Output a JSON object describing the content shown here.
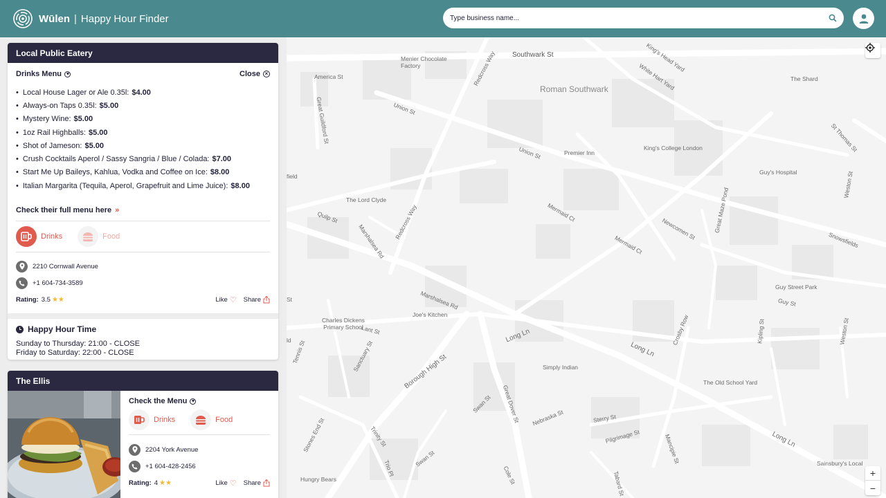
{
  "header": {
    "brand": "Wūlen",
    "separator": "|",
    "subtitle": "Happy Hour Finder",
    "search_placeholder": "Type business name..."
  },
  "colors": {
    "header_bg": "#4a8a8e",
    "card_header_bg": "#2b2842",
    "accent": "#e05a4e",
    "star": "#f5b82e"
  },
  "card1": {
    "title": "Local Public Eatery",
    "menu_title": "Drinks Menu",
    "close_label": "Close",
    "items": [
      {
        "name": "Local House Lager or Ale 0.35l:",
        "price": "$4.00"
      },
      {
        "name": "Always-on Taps 0.35l:",
        "price": "$5.00"
      },
      {
        "name": "Mystery Wine:",
        "price": "$5.00"
      },
      {
        "name": "1oz Rail Highballs:",
        "price": "$5.00"
      },
      {
        "name": "Shot of Jameson:",
        "price": "$5.00"
      },
      {
        "name": "Crush Cocktails Aperol / Sassy Sangria / Blue / Colada:",
        "price": "$7.00"
      },
      {
        "name": "Start Me Up Baileys, Kahlua, Vodka and Coffee on Ice:",
        "price": "$8.00"
      },
      {
        "name": "Italian Margarita (Tequila, Aperol, Grapefruit and Lime Juice):",
        "price": "$8.00"
      }
    ],
    "full_menu_link": "Check their full menu here",
    "drinks_label": "Drinks",
    "food_label": "Food",
    "address": "2210 Cornwall Avenue",
    "phone": "+1 604-734-3589",
    "rating_label": "Rating:",
    "rating_value": "3.5",
    "rating_stars": "★★",
    "like_label": "Like",
    "share_label": "Share",
    "happy_hour_title": "Happy Hour Time",
    "happy_hour_lines": [
      "Sunday to Thursday: 21:00 - CLOSE",
      "Friday to Saturday: 22:00 - CLOSE"
    ]
  },
  "card2": {
    "title": "The Ellis",
    "menu_link": "Check the Menu",
    "drinks_label": "Drinks",
    "food_label": "Food",
    "address": "2204 York Avenue",
    "phone": "+1 604-428-2456",
    "rating_label": "Rating:",
    "rating_value": "4",
    "rating_stars": "★★",
    "like_label": "Like",
    "share_label": "Share"
  },
  "map": {
    "labels": [
      "Southwark St",
      "Menier Chocolate Factory",
      "America St",
      "Redcross Way",
      "King's Head Yard",
      "White Hart Yard",
      "The Shard",
      "Roman Southwark",
      "Great Guildford St",
      "Union St",
      "St Thomas St",
      "Premier Inn",
      "Union St",
      "King's College London",
      "Guy's Hospital",
      "Weston St",
      "The Lord Clyde",
      "Quilp St",
      "Redcross Way",
      "Mermaid Ct",
      "Great Maze Pond",
      "Newcomen St",
      "Snowsfields",
      "Marshalsea Rd",
      "Mermaid Ct",
      "Guy Street Park",
      "Guy St",
      "Marshalsea Rd",
      "Joe's Kitchen",
      "Charles Dickens Primary School",
      "Lant St",
      "Long Ln",
      "Crosby Row",
      "Kipling St",
      "Weston St",
      "Long Ln",
      "Sanctuary St",
      "Borough High St",
      "Tennis St",
      "Simply Indian",
      "The Old School Yard",
      "Great Dover St",
      "Swan St",
      "Nebraska St",
      "Sterry St",
      "Pilgrimage St",
      "Long Ln",
      "Mancipie St",
      "Trinity St",
      "Stones End St",
      "Swan St",
      "Trio Pl",
      "Hungry Bears",
      "Cole St",
      "Tabard St",
      "Sainsbury's Local",
      "field",
      "St",
      "ld"
    ],
    "zoom_in": "+",
    "zoom_out": "−"
  }
}
